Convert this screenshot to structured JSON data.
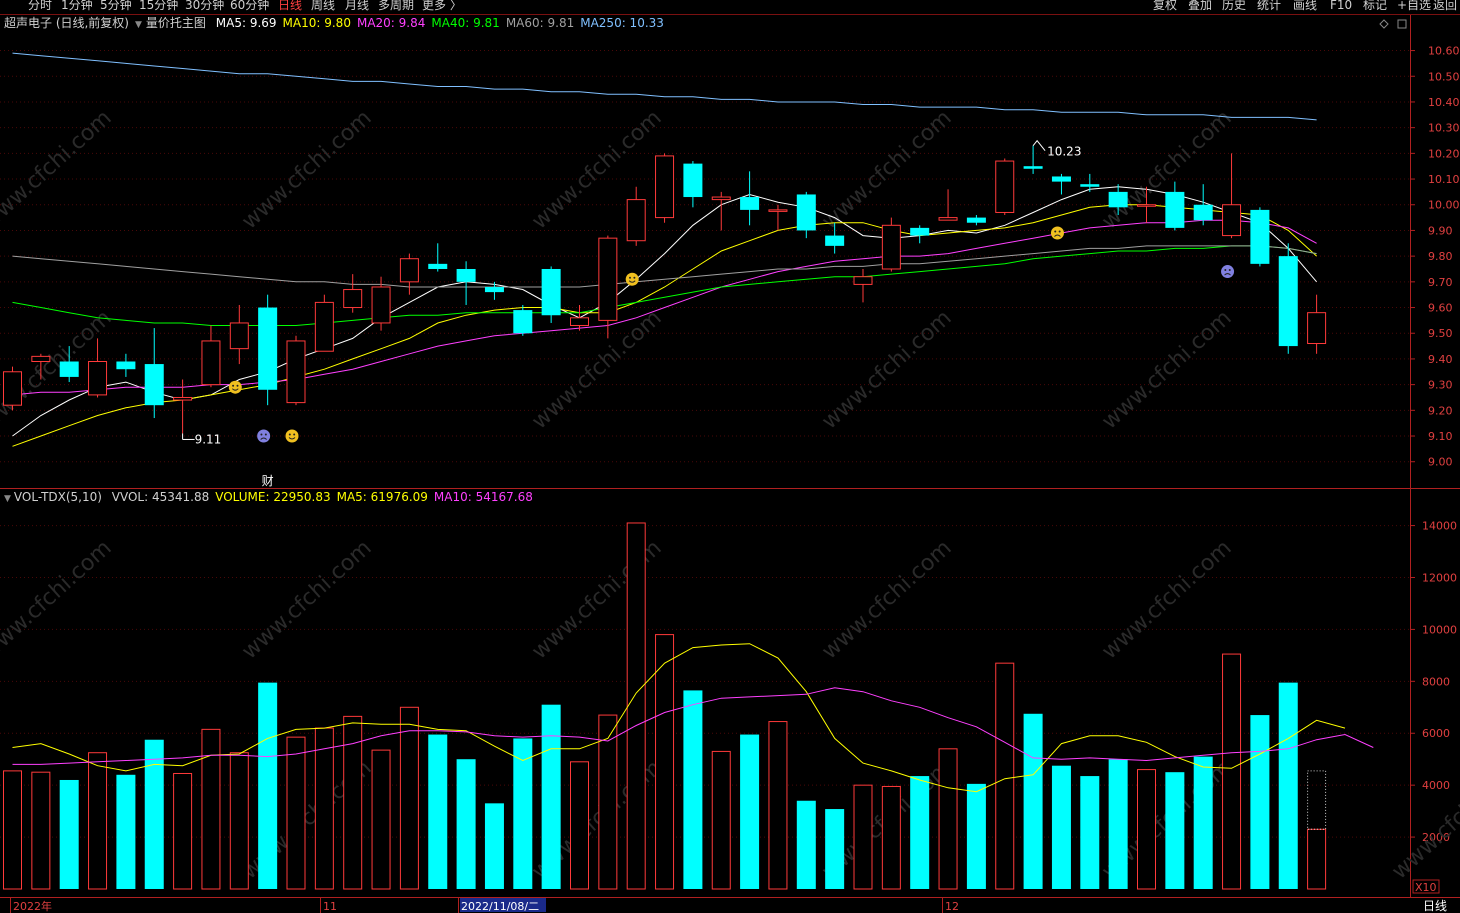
{
  "toolbar": {
    "periods": [
      "分时",
      "1分钟",
      "5分钟",
      "15分钟",
      "30分钟",
      "60分钟",
      "日线",
      "周线",
      "月线",
      "多周期",
      "更多 〉"
    ],
    "active_index": 6,
    "right_buttons": [
      "复权",
      "叠加",
      "历史",
      "统计",
      "画线",
      "F10",
      "标记",
      "+自选",
      "返回"
    ]
  },
  "main_legend": {
    "title": "超声电子 (日线,前复权)",
    "indicator": "量价托主图",
    "items": [
      {
        "label": "MA5: 9.69",
        "color": "#ffffff"
      },
      {
        "label": "MA10: 9.80",
        "color": "#ffff00"
      },
      {
        "label": "MA20: 9.84",
        "color": "#ff40ff"
      },
      {
        "label": "MA40: 9.81",
        "color": "#00ff00"
      },
      {
        "label": "MA60: 9.81",
        "color": "#a0a0a0"
      },
      {
        "label": "MA250: 10.33",
        "color": "#80c0ff"
      }
    ]
  },
  "vol_legend": {
    "title": "VOL-TDX(5,10)",
    "items": [
      {
        "label": "VVOL: 45341.88",
        "color": "#d0d0d0"
      },
      {
        "label": "VOLUME: 22950.83",
        "color": "#ffff00"
      },
      {
        "label": "MA5: 61976.09",
        "color": "#ffff00"
      },
      {
        "label": "MA10: 54167.68",
        "color": "#ff40ff"
      }
    ]
  },
  "annotations": {
    "high_label": "10.23",
    "low_label": "9.11",
    "finance_marker": "财"
  },
  "x_axis": {
    "labels": [
      {
        "text": "2022年",
        "highlight": false
      },
      {
        "text": "11",
        "highlight": false
      },
      {
        "text": "2022/11/08/二",
        "highlight": true
      },
      {
        "text": "12",
        "highlight": false
      }
    ],
    "period_label": "日线",
    "multiplier_label": "X10"
  },
  "watermark": "www.cfchi.com",
  "chart_data": [
    {
      "type": "candlestick",
      "title": "超声电子 (日线,前复权)",
      "ylim": [
        8.96,
        10.68
      ],
      "yticks": [
        "10.60",
        "10.50",
        "10.40",
        "10.30",
        "10.20",
        "10.10",
        "10.00",
        "9.90",
        "9.80",
        "9.70",
        "9.60",
        "9.50",
        "9.40",
        "9.30",
        "9.20",
        "9.10",
        "9.00"
      ],
      "candles": [
        {
          "o": 9.22,
          "c": 9.35,
          "h": 9.37,
          "l": 9.2
        },
        {
          "o": 9.39,
          "c": 9.41,
          "h": 9.42,
          "l": 9.32
        },
        {
          "o": 9.39,
          "c": 9.33,
          "h": 9.45,
          "l": 9.31
        },
        {
          "o": 9.26,
          "c": 9.39,
          "h": 9.48,
          "l": 9.25
        },
        {
          "o": 9.39,
          "c": 9.36,
          "h": 9.42,
          "l": 9.33
        },
        {
          "o": 9.38,
          "c": 9.22,
          "h": 9.52,
          "l": 9.17
        },
        {
          "o": 9.24,
          "c": 9.25,
          "h": 9.32,
          "l": 9.11
        },
        {
          "o": 9.3,
          "c": 9.47,
          "h": 9.53,
          "l": 9.29
        },
        {
          "o": 9.44,
          "c": 9.54,
          "h": 9.61,
          "l": 9.38
        },
        {
          "o": 9.6,
          "c": 9.28,
          "h": 9.65,
          "l": 9.22
        },
        {
          "o": 9.23,
          "c": 9.47,
          "h": 9.49,
          "l": 9.22
        },
        {
          "o": 9.43,
          "c": 9.62,
          "h": 9.65,
          "l": 9.43
        },
        {
          "o": 9.6,
          "c": 9.67,
          "h": 9.73,
          "l": 9.58
        },
        {
          "o": 9.54,
          "c": 9.68,
          "h": 9.72,
          "l": 9.51
        },
        {
          "o": 9.7,
          "c": 9.79,
          "h": 9.81,
          "l": 9.65
        },
        {
          "o": 9.77,
          "c": 9.75,
          "h": 9.85,
          "l": 9.74
        },
        {
          "o": 9.75,
          "c": 9.7,
          "h": 9.78,
          "l": 9.61
        },
        {
          "o": 9.68,
          "c": 9.66,
          "h": 9.7,
          "l": 9.63
        },
        {
          "o": 9.59,
          "c": 9.5,
          "h": 9.61,
          "l": 9.49
        },
        {
          "o": 9.75,
          "c": 9.57,
          "h": 9.76,
          "l": 9.54
        },
        {
          "o": 9.53,
          "c": 9.56,
          "h": 9.61,
          "l": 9.51
        },
        {
          "o": 9.55,
          "c": 9.87,
          "h": 9.88,
          "l": 9.48
        },
        {
          "o": 9.86,
          "c": 10.02,
          "h": 10.07,
          "l": 9.84
        },
        {
          "o": 9.95,
          "c": 10.19,
          "h": 10.2,
          "l": 9.93
        },
        {
          "o": 10.16,
          "c": 10.03,
          "h": 10.17,
          "l": 9.99
        },
        {
          "o": 10.02,
          "c": 10.03,
          "h": 10.05,
          "l": 9.9
        },
        {
          "o": 10.03,
          "c": 9.98,
          "h": 10.13,
          "l": 9.92
        },
        {
          "o": 9.98,
          "c": 9.98,
          "h": 10.0,
          "l": 9.9
        },
        {
          "o": 10.04,
          "c": 9.9,
          "h": 10.05,
          "l": 9.87
        },
        {
          "o": 9.88,
          "c": 9.84,
          "h": 9.93,
          "l": 9.81
        },
        {
          "o": 9.69,
          "c": 9.72,
          "h": 9.75,
          "l": 9.62
        },
        {
          "o": 9.75,
          "c": 9.92,
          "h": 9.95,
          "l": 9.74
        },
        {
          "o": 9.91,
          "c": 9.88,
          "h": 9.92,
          "l": 9.85
        },
        {
          "o": 9.94,
          "c": 9.95,
          "h": 10.06,
          "l": 9.94
        },
        {
          "o": 9.95,
          "c": 9.93,
          "h": 9.96,
          "l": 9.92
        },
        {
          "o": 9.97,
          "c": 10.17,
          "h": 10.18,
          "l": 9.96
        },
        {
          "o": 10.15,
          "c": 10.14,
          "h": 10.23,
          "l": 10.12
        },
        {
          "o": 10.11,
          "c": 10.09,
          "h": 10.12,
          "l": 10.04
        },
        {
          "o": 10.08,
          "c": 10.07,
          "h": 10.12,
          "l": 10.05
        },
        {
          "o": 10.05,
          "c": 9.99,
          "h": 10.08,
          "l": 9.96
        },
        {
          "o": 10.0,
          "c": 10.0,
          "h": 10.07,
          "l": 9.93
        },
        {
          "o": 10.05,
          "c": 9.91,
          "h": 10.09,
          "l": 9.9
        },
        {
          "o": 10.0,
          "c": 9.94,
          "h": 10.08,
          "l": 9.92
        },
        {
          "o": 9.88,
          "c": 10.0,
          "h": 10.2,
          "l": 9.87
        },
        {
          "o": 9.98,
          "c": 9.77,
          "h": 9.99,
          "l": 9.76
        },
        {
          "o": 9.8,
          "c": 9.45,
          "h": 9.85,
          "l": 9.42
        },
        {
          "o": 9.46,
          "c": 9.58,
          "h": 9.65,
          "l": 9.42
        }
      ],
      "series": [
        {
          "name": "MA5",
          "color": "#ffffff",
          "values": [
            9.1,
            9.18,
            9.24,
            9.29,
            9.31,
            9.27,
            9.24,
            9.26,
            9.32,
            9.35,
            9.4,
            9.44,
            9.48,
            9.56,
            9.62,
            9.68,
            9.7,
            9.69,
            9.67,
            9.61,
            9.56,
            9.62,
            9.71,
            9.81,
            9.92,
            10.0,
            10.04,
            10.01,
            9.99,
            9.95,
            9.88,
            9.87,
            9.88,
            9.9,
            9.89,
            9.92,
            9.97,
            10.02,
            10.06,
            10.07,
            10.06,
            10.04,
            10.01,
            9.97,
            9.93,
            9.83,
            9.7
          ]
        },
        {
          "name": "MA10",
          "color": "#ffff00",
          "values": [
            9.06,
            9.1,
            9.14,
            9.18,
            9.21,
            9.23,
            9.24,
            9.26,
            9.28,
            9.3,
            9.33,
            9.36,
            9.4,
            9.44,
            9.48,
            9.54,
            9.57,
            9.59,
            9.6,
            9.6,
            9.58,
            9.58,
            9.62,
            9.68,
            9.75,
            9.82,
            9.86,
            9.9,
            9.92,
            9.93,
            9.93,
            9.9,
            9.88,
            9.89,
            9.9,
            9.91,
            9.93,
            9.96,
            9.99,
            10.0,
            10.0,
            9.99,
            9.98,
            9.97,
            9.96,
            9.9,
            9.8
          ]
        },
        {
          "name": "MA20",
          "color": "#ff40ff",
          "values": [
            9.26,
            9.27,
            9.27,
            9.28,
            9.29,
            9.29,
            9.29,
            9.3,
            9.3,
            9.31,
            9.32,
            9.34,
            9.36,
            9.39,
            9.42,
            9.45,
            9.47,
            9.49,
            9.5,
            9.51,
            9.52,
            9.53,
            9.56,
            9.6,
            9.64,
            9.68,
            9.71,
            9.74,
            9.76,
            9.78,
            9.79,
            9.8,
            9.8,
            9.81,
            9.83,
            9.85,
            9.87,
            9.89,
            9.91,
            9.92,
            9.93,
            9.93,
            9.94,
            9.94,
            9.93,
            9.91,
            9.85
          ]
        },
        {
          "name": "MA40",
          "color": "#00ff00",
          "values": [
            9.62,
            9.6,
            9.58,
            9.56,
            9.55,
            9.54,
            9.54,
            9.53,
            9.53,
            9.53,
            9.53,
            9.54,
            9.55,
            9.56,
            9.57,
            9.57,
            9.58,
            9.58,
            9.58,
            9.58,
            9.58,
            9.6,
            9.62,
            9.64,
            9.66,
            9.68,
            9.69,
            9.7,
            9.71,
            9.72,
            9.72,
            9.73,
            9.74,
            9.75,
            9.76,
            9.77,
            9.79,
            9.8,
            9.81,
            9.82,
            9.82,
            9.83,
            9.83,
            9.84,
            9.84,
            9.83,
            9.81
          ]
        },
        {
          "name": "MA60",
          "color": "#a0a0a0",
          "values": [
            9.8,
            9.79,
            9.78,
            9.77,
            9.76,
            9.75,
            9.74,
            9.73,
            9.72,
            9.71,
            9.7,
            9.7,
            9.69,
            9.69,
            9.68,
            9.68,
            9.68,
            9.68,
            9.68,
            9.68,
            9.68,
            9.69,
            9.7,
            9.71,
            9.72,
            9.73,
            9.74,
            9.75,
            9.75,
            9.76,
            9.76,
            9.77,
            9.77,
            9.78,
            9.79,
            9.8,
            9.81,
            9.82,
            9.83,
            9.83,
            9.84,
            9.84,
            9.84,
            9.84,
            9.84,
            9.83,
            9.81
          ]
        },
        {
          "name": "MA250",
          "color": "#80c0ff",
          "values": [
            10.59,
            10.58,
            10.57,
            10.56,
            10.55,
            10.54,
            10.53,
            10.52,
            10.51,
            10.51,
            10.5,
            10.49,
            10.48,
            10.48,
            10.47,
            10.46,
            10.46,
            10.45,
            10.45,
            10.44,
            10.44,
            10.43,
            10.43,
            10.42,
            10.42,
            10.41,
            10.41,
            10.4,
            10.4,
            10.4,
            10.39,
            10.39,
            10.38,
            10.38,
            10.38,
            10.37,
            10.37,
            10.36,
            10.36,
            10.36,
            10.35,
            10.35,
            10.35,
            10.34,
            10.34,
            10.34,
            10.33
          ]
        }
      ],
      "emoji_markers": [
        {
          "index": 8,
          "price": 9.29,
          "mood": "happy"
        },
        {
          "index": 9,
          "price": 9.1,
          "mood": "sad"
        },
        {
          "index": 10,
          "price": 9.1,
          "mood": "happy"
        },
        {
          "index": 22,
          "price": 9.71,
          "mood": "happy"
        },
        {
          "index": 37,
          "price": 9.89,
          "mood": "unhappy"
        },
        {
          "index": 43,
          "price": 9.74,
          "mood": "sad"
        }
      ]
    },
    {
      "type": "bar",
      "title": "VOL-TDX(5,10)",
      "ylim": [
        0,
        14600
      ],
      "yticks": [
        "14000",
        "12000",
        "10000",
        "8000",
        "6000",
        "4000",
        "2000"
      ],
      "volumes": [
        4550,
        4500,
        4200,
        5250,
        4400,
        5750,
        4450,
        6150,
        5250,
        7950,
        5850,
        6200,
        6650,
        5350,
        7000,
        5950,
        5000,
        3300,
        5800,
        7100,
        4900,
        6700,
        14100,
        9800,
        7650,
        5300,
        5950,
        6450,
        3400,
        3080,
        4000,
        3950,
        4350,
        5400,
        4050,
        8700,
        6750,
        4750,
        4350,
        5000,
        4600,
        4500,
        5100,
        9050,
        6700,
        7950,
        2300
      ],
      "series": [
        {
          "name": "MA5",
          "color": "#ffff00",
          "values": [
            5450,
            5600,
            5200,
            4750,
            4550,
            4800,
            4750,
            5150,
            5200,
            5800,
            6150,
            6200,
            6400,
            6350,
            6350,
            6150,
            6100,
            5500,
            4950,
            5400,
            5400,
            5800,
            7550,
            8700,
            9300,
            9400,
            9450,
            8900,
            7600,
            5800,
            4850,
            4550,
            4200,
            3900,
            3750,
            4250,
            4400,
            5600,
            5900,
            5900,
            5650,
            5100,
            4700,
            4650,
            5200,
            5800,
            6500,
            6200
          ]
        },
        {
          "name": "MA10",
          "color": "#ff40ff",
          "values": [
            4800,
            4800,
            4850,
            4900,
            4950,
            5000,
            5050,
            5150,
            5150,
            5100,
            5200,
            5400,
            5600,
            5900,
            6100,
            6100,
            6050,
            5900,
            5850,
            5900,
            5850,
            5700,
            6300,
            6800,
            7100,
            7350,
            7400,
            7450,
            7500,
            7750,
            7600,
            7250,
            7000,
            6600,
            6250,
            5650,
            5050,
            5000,
            5050,
            5000,
            4950,
            5050,
            5150,
            5250,
            5300,
            5400,
            5750,
            5950,
            5450
          ]
        }
      ]
    }
  ]
}
